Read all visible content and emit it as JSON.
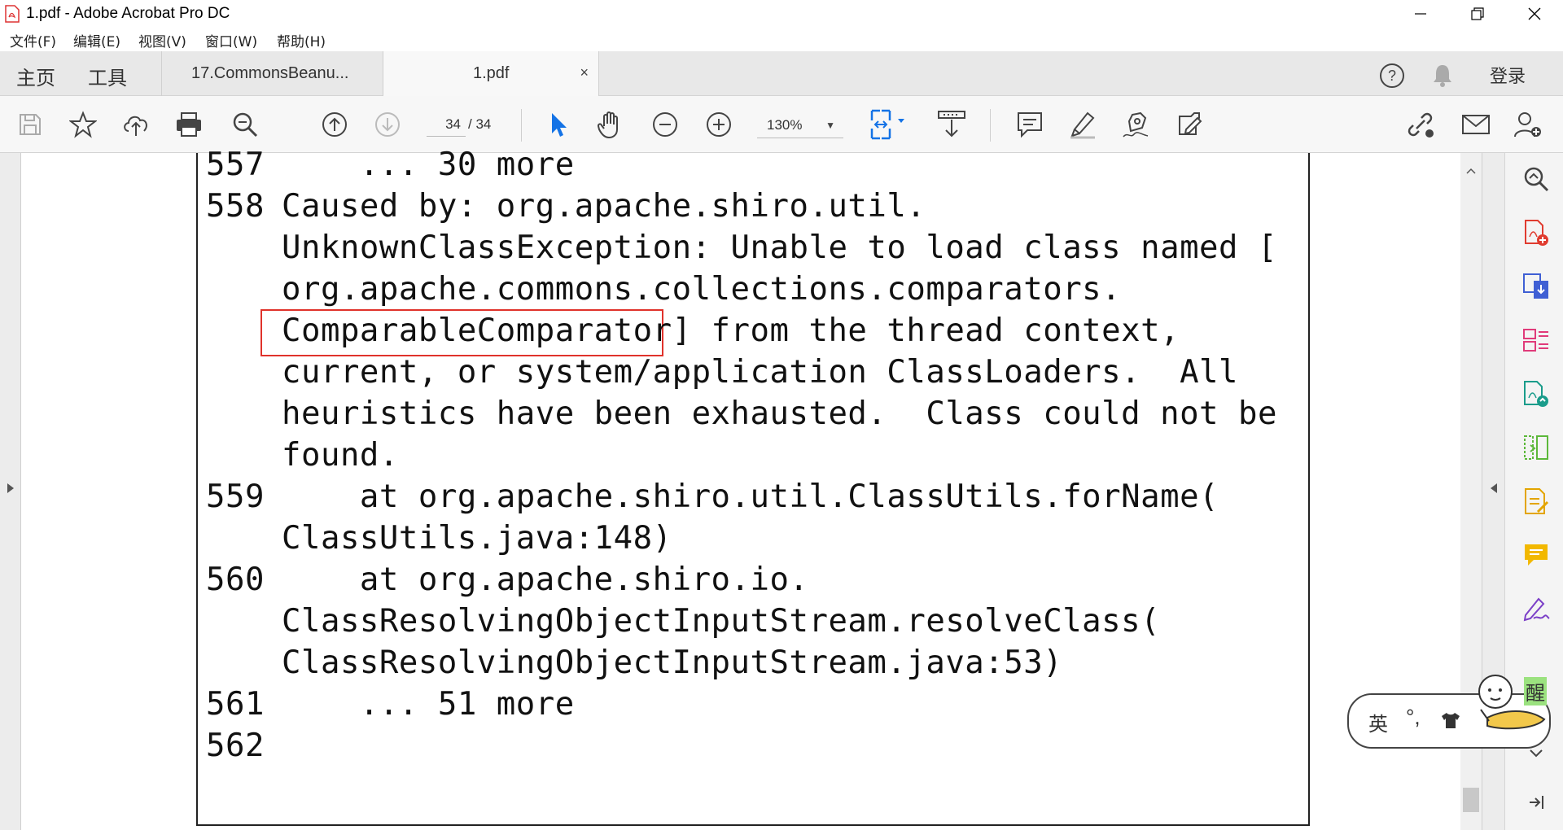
{
  "window": {
    "title": "1.pdf - Adobe Acrobat Pro DC",
    "app_icon": "acrobat-pdf-icon",
    "controls": [
      "minimize-icon",
      "restore-icon",
      "close-icon"
    ]
  },
  "menubar": {
    "items": [
      "文件(F)",
      "编辑(E)",
      "视图(V)",
      "窗口(W)",
      "帮助(H)"
    ]
  },
  "tabbar": {
    "home": "主页",
    "tools": "工具",
    "tabs": [
      {
        "label": "17.CommonsBeanu...",
        "active": false
      },
      {
        "label": "1.pdf",
        "active": true,
        "close": "×"
      }
    ],
    "help_icon": "help-circle-icon",
    "notification_icon": "bell-icon",
    "signin": "登录"
  },
  "toolbar": {
    "page_current": "34",
    "page_total": "/ 34",
    "zoom": "130%",
    "icons": [
      "save-icon",
      "bookmark-star-icon",
      "upload-cloud-icon",
      "print-icon",
      "search-zoom-icon",
      "page-up-icon",
      "page-down-icon",
      "select-pointer-icon",
      "hand-pan-icon",
      "zoom-out-icon",
      "zoom-in-icon",
      "fit-page-icon",
      "scroll-mode-icon",
      "comment-icon",
      "highlight-pen-icon",
      "sign-pen-icon",
      "edit-pdf-icon",
      "share-link-icon",
      "email-icon",
      "add-user-icon"
    ]
  },
  "document": {
    "lines": [
      {
        "num": "557",
        "text": "    ... 30 more"
      },
      {
        "num": "558",
        "text": "Caused by: org.apache.shiro.util."
      },
      {
        "num": "",
        "text": "UnknownClassException: Unable to load class named ["
      },
      {
        "num": "",
        "text": "org.apache.commons.collections.comparators."
      },
      {
        "num": "",
        "text": "ComparableComparator] from the thread context,"
      },
      {
        "num": "",
        "text": "current, or system/application ClassLoaders.  All"
      },
      {
        "num": "",
        "text": "heuristics have been exhausted.  Class could not be"
      },
      {
        "num": "",
        "text": "found."
      },
      {
        "num": "559",
        "text": "    at org.apache.shiro.util.ClassUtils.forName("
      },
      {
        "num": "",
        "text": "ClassUtils.java:148)"
      },
      {
        "num": "560",
        "text": "    at org.apache.shiro.io."
      },
      {
        "num": "",
        "text": "ClassResolvingObjectInputStream.resolveClass("
      },
      {
        "num": "",
        "text": "ClassResolvingObjectInputStream.java:53)"
      },
      {
        "num": "561",
        "text": "    ... 51 more"
      },
      {
        "num": "562",
        "text": ""
      }
    ],
    "highlight_color": "#e0322b"
  },
  "rightpane": {
    "icons": [
      "zoom-search-icon",
      "create-pdf-icon",
      "export-pdf-icon",
      "organize-pages-icon",
      "convert-pdf-icon",
      "compare-icon",
      "fill-sign-icon",
      "comment-icon",
      "sign-icon",
      "collapse-icon"
    ]
  },
  "ime": {
    "mode": "英",
    "punct": "°,",
    "badge": "醒"
  }
}
